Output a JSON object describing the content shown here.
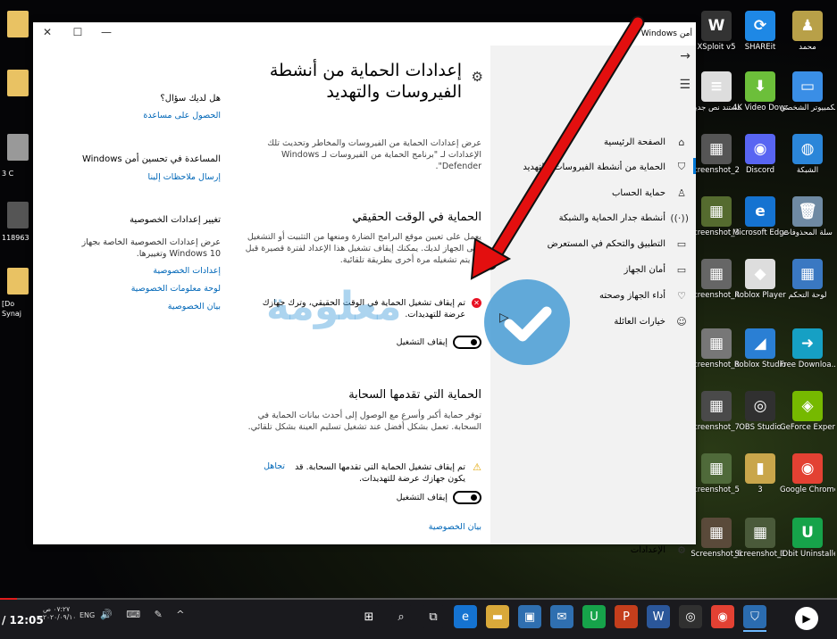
{
  "window": {
    "title": "أمن Windows",
    "controls": {
      "close": "✕",
      "maximize": "☐",
      "minimize": "—"
    }
  },
  "nav": {
    "back_icon": "→",
    "menu_icon": "☰",
    "items": [
      {
        "label": "الصفحة الرئيسية",
        "icon": "⌂"
      },
      {
        "label": "الحماية من أنشطة الفيروسات والتهديد",
        "icon": "⛉"
      },
      {
        "label": "حماية الحساب",
        "icon": "♙"
      },
      {
        "label": "أنشطة جدار الحماية والشبكة",
        "icon": "((·))"
      },
      {
        "label": "التطبيق والتحكم في المستعرض",
        "icon": "▭"
      },
      {
        "label": "أمان الجهاز",
        "icon": "▭"
      },
      {
        "label": "أداء الجهاز وصحته",
        "icon": "♡"
      },
      {
        "label": "خيارات العائلة",
        "icon": "☺"
      }
    ],
    "settings": {
      "label": "الإعدادات",
      "icon": "⚙"
    }
  },
  "main": {
    "title": "إعدادات الحماية من أنشطة الفيروسات والتهديد",
    "title_icon": "⚙",
    "intro": "عرض إعدادات الحماية من الفيروسات والمخاطر وتحديث تلك الإعدادات لـ \"برنامج الحماية من الفيروسات لـ Windows Defender\".",
    "realtime": {
      "title": "الحماية في الوقت الحقيقي",
      "description": "يعمل على تعيين موقع البرامج الضارة ومنعها من التثبيت أو التشغيل على الجهاز لديك. يمكنك إيقاف تشغيل هذا الإعداد لفترة قصيرة قبل أن يتم تشغيله مرة أخرى بطريقة تلقائية.",
      "status": "تم إيقاف تشغيل الحماية في الوقت الحقيقي، وترك جهازك عرضة للتهديدات.",
      "toggle_label": "إيقاف التشغيل"
    },
    "cloud": {
      "title": "الحماية التي تقدمها السحابة",
      "description": "توفر حماية أكبر وأسرع مع الوصول إلى أحدث بيانات الحماية في السحابة. تعمل بشكل أفضل عند تشغيل تسليم العينة بشكل تلقائي.",
      "status": "تم إيقاف تشغيل الحماية التي تقدمها السحابة. قد يكون جهازك عرضة للتهديدات.",
      "dismiss": "تجاهل",
      "toggle_label": "إيقاف التشغيل"
    },
    "privacy_link": "بيان الخصوصية"
  },
  "side": {
    "question_title": "هل لديك سؤال؟",
    "help_link": "الحصول على مساعدة",
    "improve_title": "المساعدة في تحسين أمن Windows",
    "feedback_link": "إرسال ملاحظات إلينا",
    "privacy_title": "تغيير إعدادات الخصوصية",
    "privacy_text": "عرض إعدادات الخصوصية الخاصة بجهاز Windows 10 وتغييرها.",
    "links": [
      "إعدادات الخصوصية",
      "لوحة معلومات الخصوصية",
      "بيان الخصوصية"
    ]
  },
  "watermark": "معلومة",
  "desktop": {
    "left_labels": [
      "3 C",
      "118963",
      "[Do",
      "Synaj"
    ],
    "icons": [
      {
        "label": "XSploit v5",
        "glyph": "W",
        "color": "#333333"
      },
      {
        "label": "SHAREit",
        "glyph": "⟳",
        "color": "#1e88e5"
      },
      {
        "label": "محمد",
        "glyph": "♟",
        "color": "#b8a048"
      },
      {
        "label": "مستند نص جديد",
        "glyph": "≡",
        "color": "#dddddd"
      },
      {
        "label": "4K Video Downloader",
        "glyph": "⬇",
        "color": "#6cbf3a"
      },
      {
        "label": "هذا الكمبيوتر الشخصي",
        "glyph": "▭",
        "color": "#3a8ee6"
      },
      {
        "label": "creenshot_2",
        "glyph": "▦",
        "color": "#555555"
      },
      {
        "label": "Discord",
        "glyph": "◉",
        "color": "#5865f2"
      },
      {
        "label": "الشبكة",
        "glyph": "◍",
        "color": "#2b86d9"
      },
      {
        "label": "creenshot_3",
        "glyph": "▦",
        "color": "#556b2f"
      },
      {
        "label": "Microsoft Edge",
        "glyph": "e",
        "color": "#1573d1"
      },
      {
        "label": "سلة المحذوفات",
        "glyph": "🗑",
        "color": "#6f8aa3"
      },
      {
        "label": "creenshot_4",
        "glyph": "▦",
        "color": "#666666"
      },
      {
        "label": "Roblox Player",
        "glyph": "◆",
        "color": "#dddddd"
      },
      {
        "label": "لوحة التحكم",
        "glyph": "▦",
        "color": "#3a78c2"
      },
      {
        "label": "creenshot_8",
        "glyph": "▦",
        "color": "#777777"
      },
      {
        "label": "Roblox Studio",
        "glyph": "◢",
        "color": "#2a7fd4"
      },
      {
        "label": "Free Downloa...",
        "glyph": "➜",
        "color": "#16a0c4"
      },
      {
        "label": "creenshot_7",
        "glyph": "▦",
        "color": "#4a4a4a"
      },
      {
        "label": "OBS Studio",
        "glyph": "◎",
        "color": "#303030"
      },
      {
        "label": "GeForce Experience",
        "glyph": "◈",
        "color": "#76b900"
      },
      {
        "label": "creenshot_5",
        "glyph": "▦",
        "color": "#4f6a3a"
      },
      {
        "label": "3",
        "glyph": "▮",
        "color": "#c9a64b"
      },
      {
        "label": "Google Chrome",
        "glyph": "◉",
        "color": "#e34133"
      },
      {
        "label": "Screenshot_6",
        "glyph": "▦",
        "color": "#5a4a3a"
      },
      {
        "label": "Screenshot_1",
        "glyph": "▦",
        "color": "#4a5a3a"
      },
      {
        "label": "IObit Uninstaller",
        "glyph": "U",
        "color": "#16a34a"
      }
    ]
  },
  "taskbar": {
    "video_time": "/ 12:05",
    "clock_time": "٠٧:٢٧ ص",
    "clock_date": "٢٠٢٠/٠٩/١٠",
    "lang": "ENG",
    "sys_icons": "🔊 ⌨ ✎ ^",
    "apps": [
      {
        "name": "start",
        "glyph": "⊞",
        "color": "#1a1a1e"
      },
      {
        "name": "search",
        "glyph": "⌕",
        "color": "#1a1a1e"
      },
      {
        "name": "task-view",
        "glyph": "⧉",
        "color": "#1a1a1e"
      },
      {
        "name": "edge",
        "glyph": "e",
        "color": "#1573d1"
      },
      {
        "name": "file-explorer",
        "glyph": "▬",
        "color": "#d9a93a"
      },
      {
        "name": "store",
        "glyph": "▣",
        "color": "#2f6fb0"
      },
      {
        "name": "mail",
        "glyph": "✉",
        "color": "#2f6fb0"
      },
      {
        "name": "iobit",
        "glyph": "U",
        "color": "#16a34a"
      },
      {
        "name": "powerpoint",
        "glyph": "P",
        "color": "#c43e1c"
      },
      {
        "name": "word",
        "glyph": "W",
        "color": "#2b579a"
      },
      {
        "name": "obs",
        "glyph": "◎",
        "color": "#303030"
      },
      {
        "name": "chrome",
        "glyph": "◉",
        "color": "#e34133"
      },
      {
        "name": "security",
        "glyph": "⛉",
        "color": "#2b6cb0"
      }
    ]
  },
  "video_progress": 0.02
}
